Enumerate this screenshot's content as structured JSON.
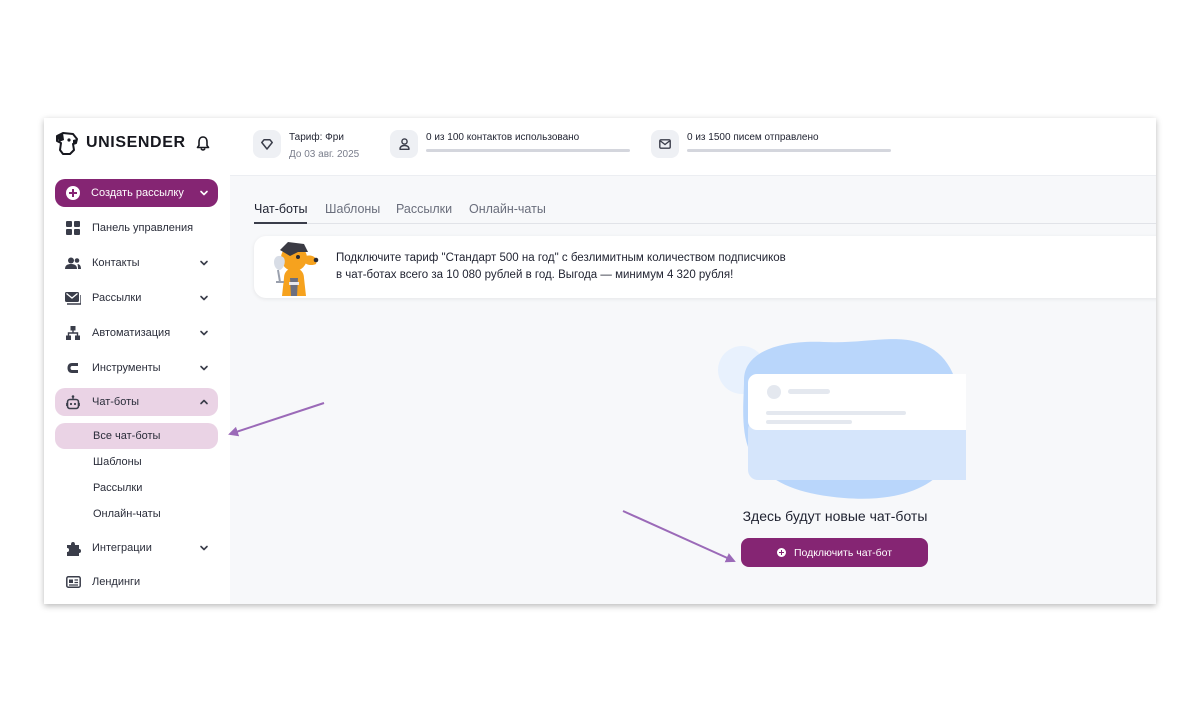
{
  "app": {
    "brand": "UNISENDER"
  },
  "sidebar": {
    "create_label": "Создать рассылку",
    "items": [
      {
        "label": "Панель управления",
        "icon": "dashboard-icon"
      },
      {
        "label": "Контакты",
        "icon": "contacts-icon"
      },
      {
        "label": "Рассылки",
        "icon": "mail-icon"
      },
      {
        "label": "Автоматизация",
        "icon": "automation-icon"
      },
      {
        "label": "Инструменты",
        "icon": "tools-icon"
      },
      {
        "label": "Чат-боты",
        "icon": "robot-icon",
        "expanded": true
      },
      {
        "label": "Интеграции",
        "icon": "puzzle-icon"
      },
      {
        "label": "Лендинги",
        "icon": "landing-icon"
      }
    ],
    "chatbot_sub": [
      {
        "label": "Все чат-боты",
        "active": true
      },
      {
        "label": "Шаблоны"
      },
      {
        "label": "Рассылки"
      },
      {
        "label": "Онлайн-чаты"
      }
    ]
  },
  "topbar": {
    "plan": {
      "title": "Тариф: Фри",
      "until": "До 03 авг. 2025"
    },
    "contacts": {
      "text": "0 из 100 контактов использовано",
      "used": 0,
      "total": 100
    },
    "letters": {
      "text": "0 из 1500 писем отправлено",
      "used": 0,
      "total": 1500
    }
  },
  "tabs": [
    {
      "label": "Чат-боты",
      "active": true
    },
    {
      "label": "Шаблоны"
    },
    {
      "label": "Рассылки"
    },
    {
      "label": "Онлайн-чаты"
    }
  ],
  "promo": {
    "line1": "Подключите тариф \"Стандарт 500 на год\" с безлимитным количеством подписчиков",
    "line2": "в чат-ботах всего за 10 080 рублей в год. Выгода — минимум 4 320 рубля!"
  },
  "empty": {
    "title": "Здесь будут новые чат-боты",
    "button_label": "Подключить чат-бот"
  },
  "colors": {
    "accent": "#852573",
    "accent_light": "#ead3e5",
    "arrow": "#9b6ab8",
    "blob": "#b9d6fb"
  }
}
